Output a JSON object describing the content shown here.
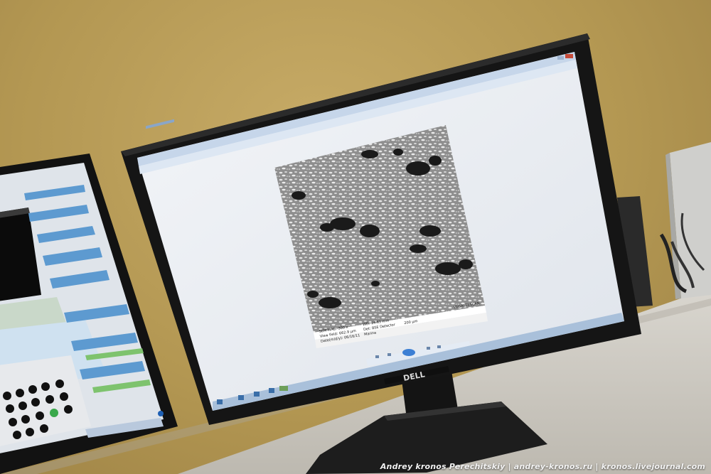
{
  "scene": {
    "monitor_brand": "DELL",
    "credit": "Andrey kronos Perechitskiy | andrey-kronos.ru | kronos.livejournal.com"
  },
  "sem_info": {
    "mag": "SEM MAG: 300 x",
    "wd": "WD: 14.69 mm",
    "view_field": "View field: 662.9 μm",
    "detector": "Det: BSE Detector",
    "date": "Date(m/d/y): 06/16/11",
    "operator": "Marina",
    "scale": "200 μm",
    "brand": "VEGA\\ TESCAN"
  },
  "colors": {
    "wall": "#b59a55",
    "screen": "#e9edf3",
    "bezel": "#151515",
    "sem_gray": "#9a9a9a"
  }
}
